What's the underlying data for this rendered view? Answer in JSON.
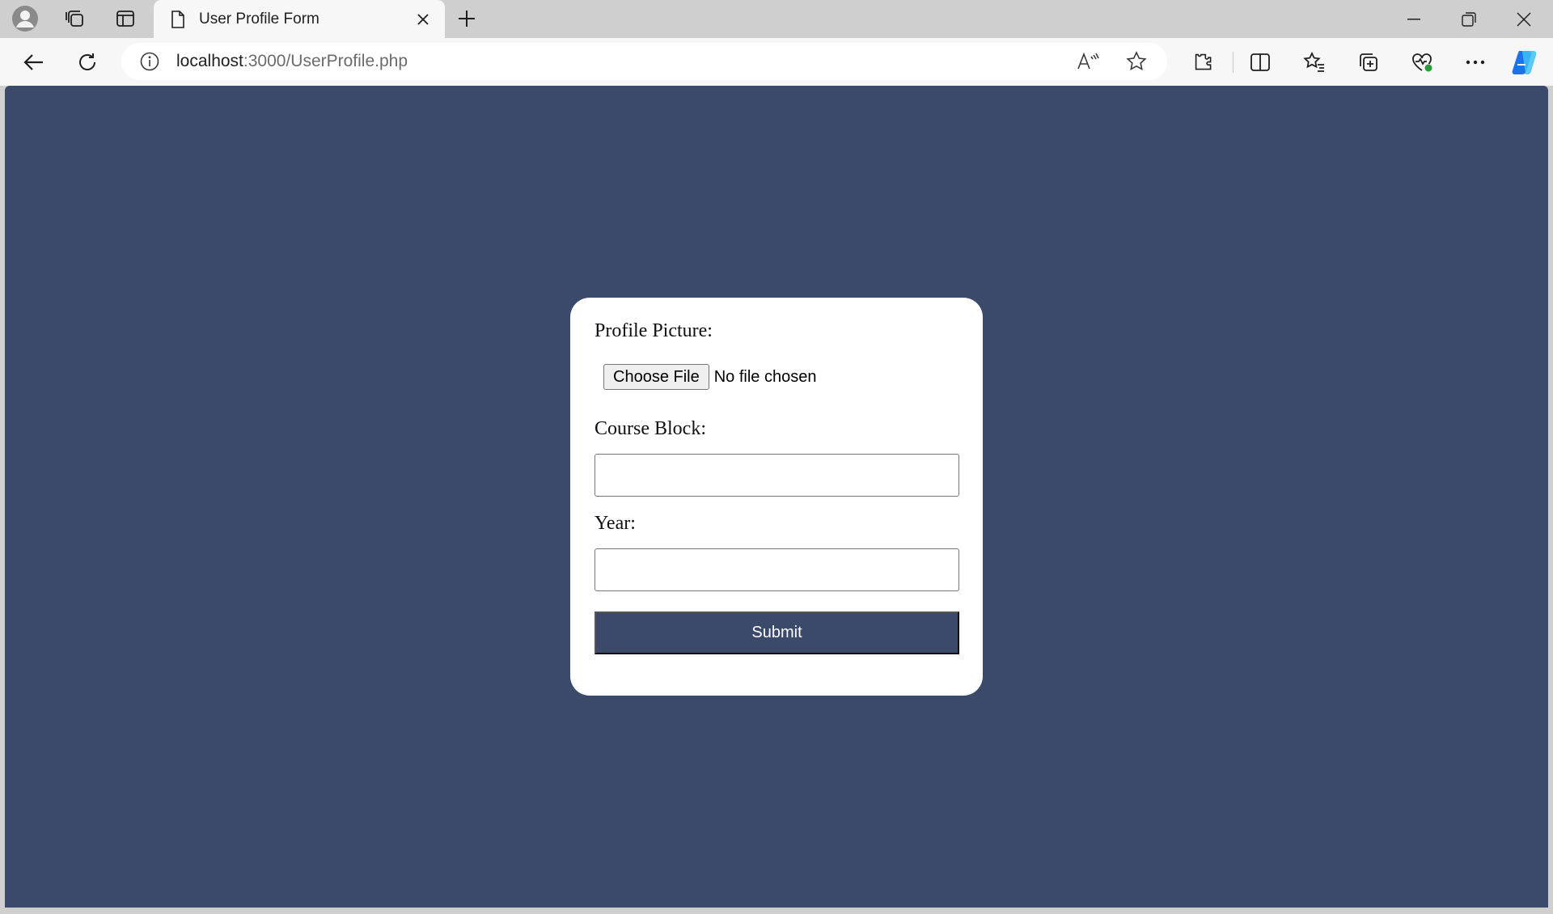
{
  "browser": {
    "tab_title": "User Profile Form",
    "url_host": "localhost",
    "url_path": ":3000/UserProfile.php"
  },
  "form": {
    "profile_picture_label": "Profile Picture:",
    "choose_file_label": "Choose File",
    "file_status": "No file chosen",
    "course_block_label": "Course Block:",
    "course_block_value": "",
    "year_label": "Year:",
    "year_value": "",
    "submit_label": "Submit"
  },
  "colors": {
    "page_background": "#3b4a6b",
    "card_background": "#ffffff",
    "submit_background": "#3b4a6b"
  }
}
